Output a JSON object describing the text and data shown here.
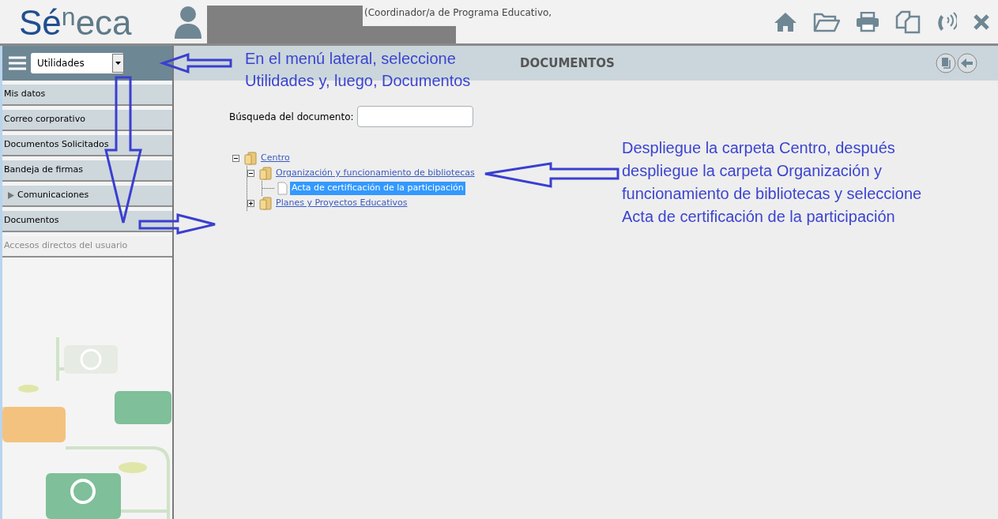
{
  "header": {
    "logo_parts": [
      "Sé",
      "n",
      "eca"
    ],
    "user_role": "(Coordinador/a de Programa Educativo,"
  },
  "sidebar": {
    "menu_select": "Utilidades",
    "items": [
      {
        "label": "Mis datos",
        "kind": "link",
        "disabled": false
      },
      {
        "label": "Correo corporativo",
        "kind": "link",
        "disabled": false
      },
      {
        "label": "Documentos Solicitados",
        "kind": "link",
        "disabled": false
      },
      {
        "label": "Bandeja de firmas",
        "kind": "link",
        "disabled": false
      },
      {
        "label": "Comunicaciones",
        "kind": "group",
        "disabled": false
      },
      {
        "label": "Documentos",
        "kind": "link",
        "disabled": false
      },
      {
        "label": "Accesos directos del usuario",
        "kind": "link",
        "disabled": true
      }
    ]
  },
  "page": {
    "title": "DOCUMENTOS",
    "search": {
      "label": "Búsqueda del documento:"
    },
    "tree": [
      {
        "label": "Centro",
        "kind": "folder",
        "expanded": true,
        "selected": false,
        "children": [
          {
            "label": "Organización y funcionamiento de bibliotecas",
            "kind": "folder",
            "expanded": true,
            "selected": false,
            "children": [
              {
                "label": "Acta de certificación de la participación",
                "kind": "document",
                "selected": true
              }
            ]
          },
          {
            "label": "Planes y Proyectos Educativos",
            "kind": "folder",
            "expanded": false,
            "selected": false
          }
        ]
      }
    ]
  },
  "annotations": [
    {
      "lines": [
        "En el menú lateral, seleccione",
        "Utilidades y, luego, Documentos"
      ]
    },
    {
      "lines": [
        "Despliegue la carpeta Centro, después",
        "despliegue la carpeta Organización y",
        "funcionamiento de bibliotecas y seleccione",
        "Acta de certificación de la participación"
      ]
    }
  ]
}
